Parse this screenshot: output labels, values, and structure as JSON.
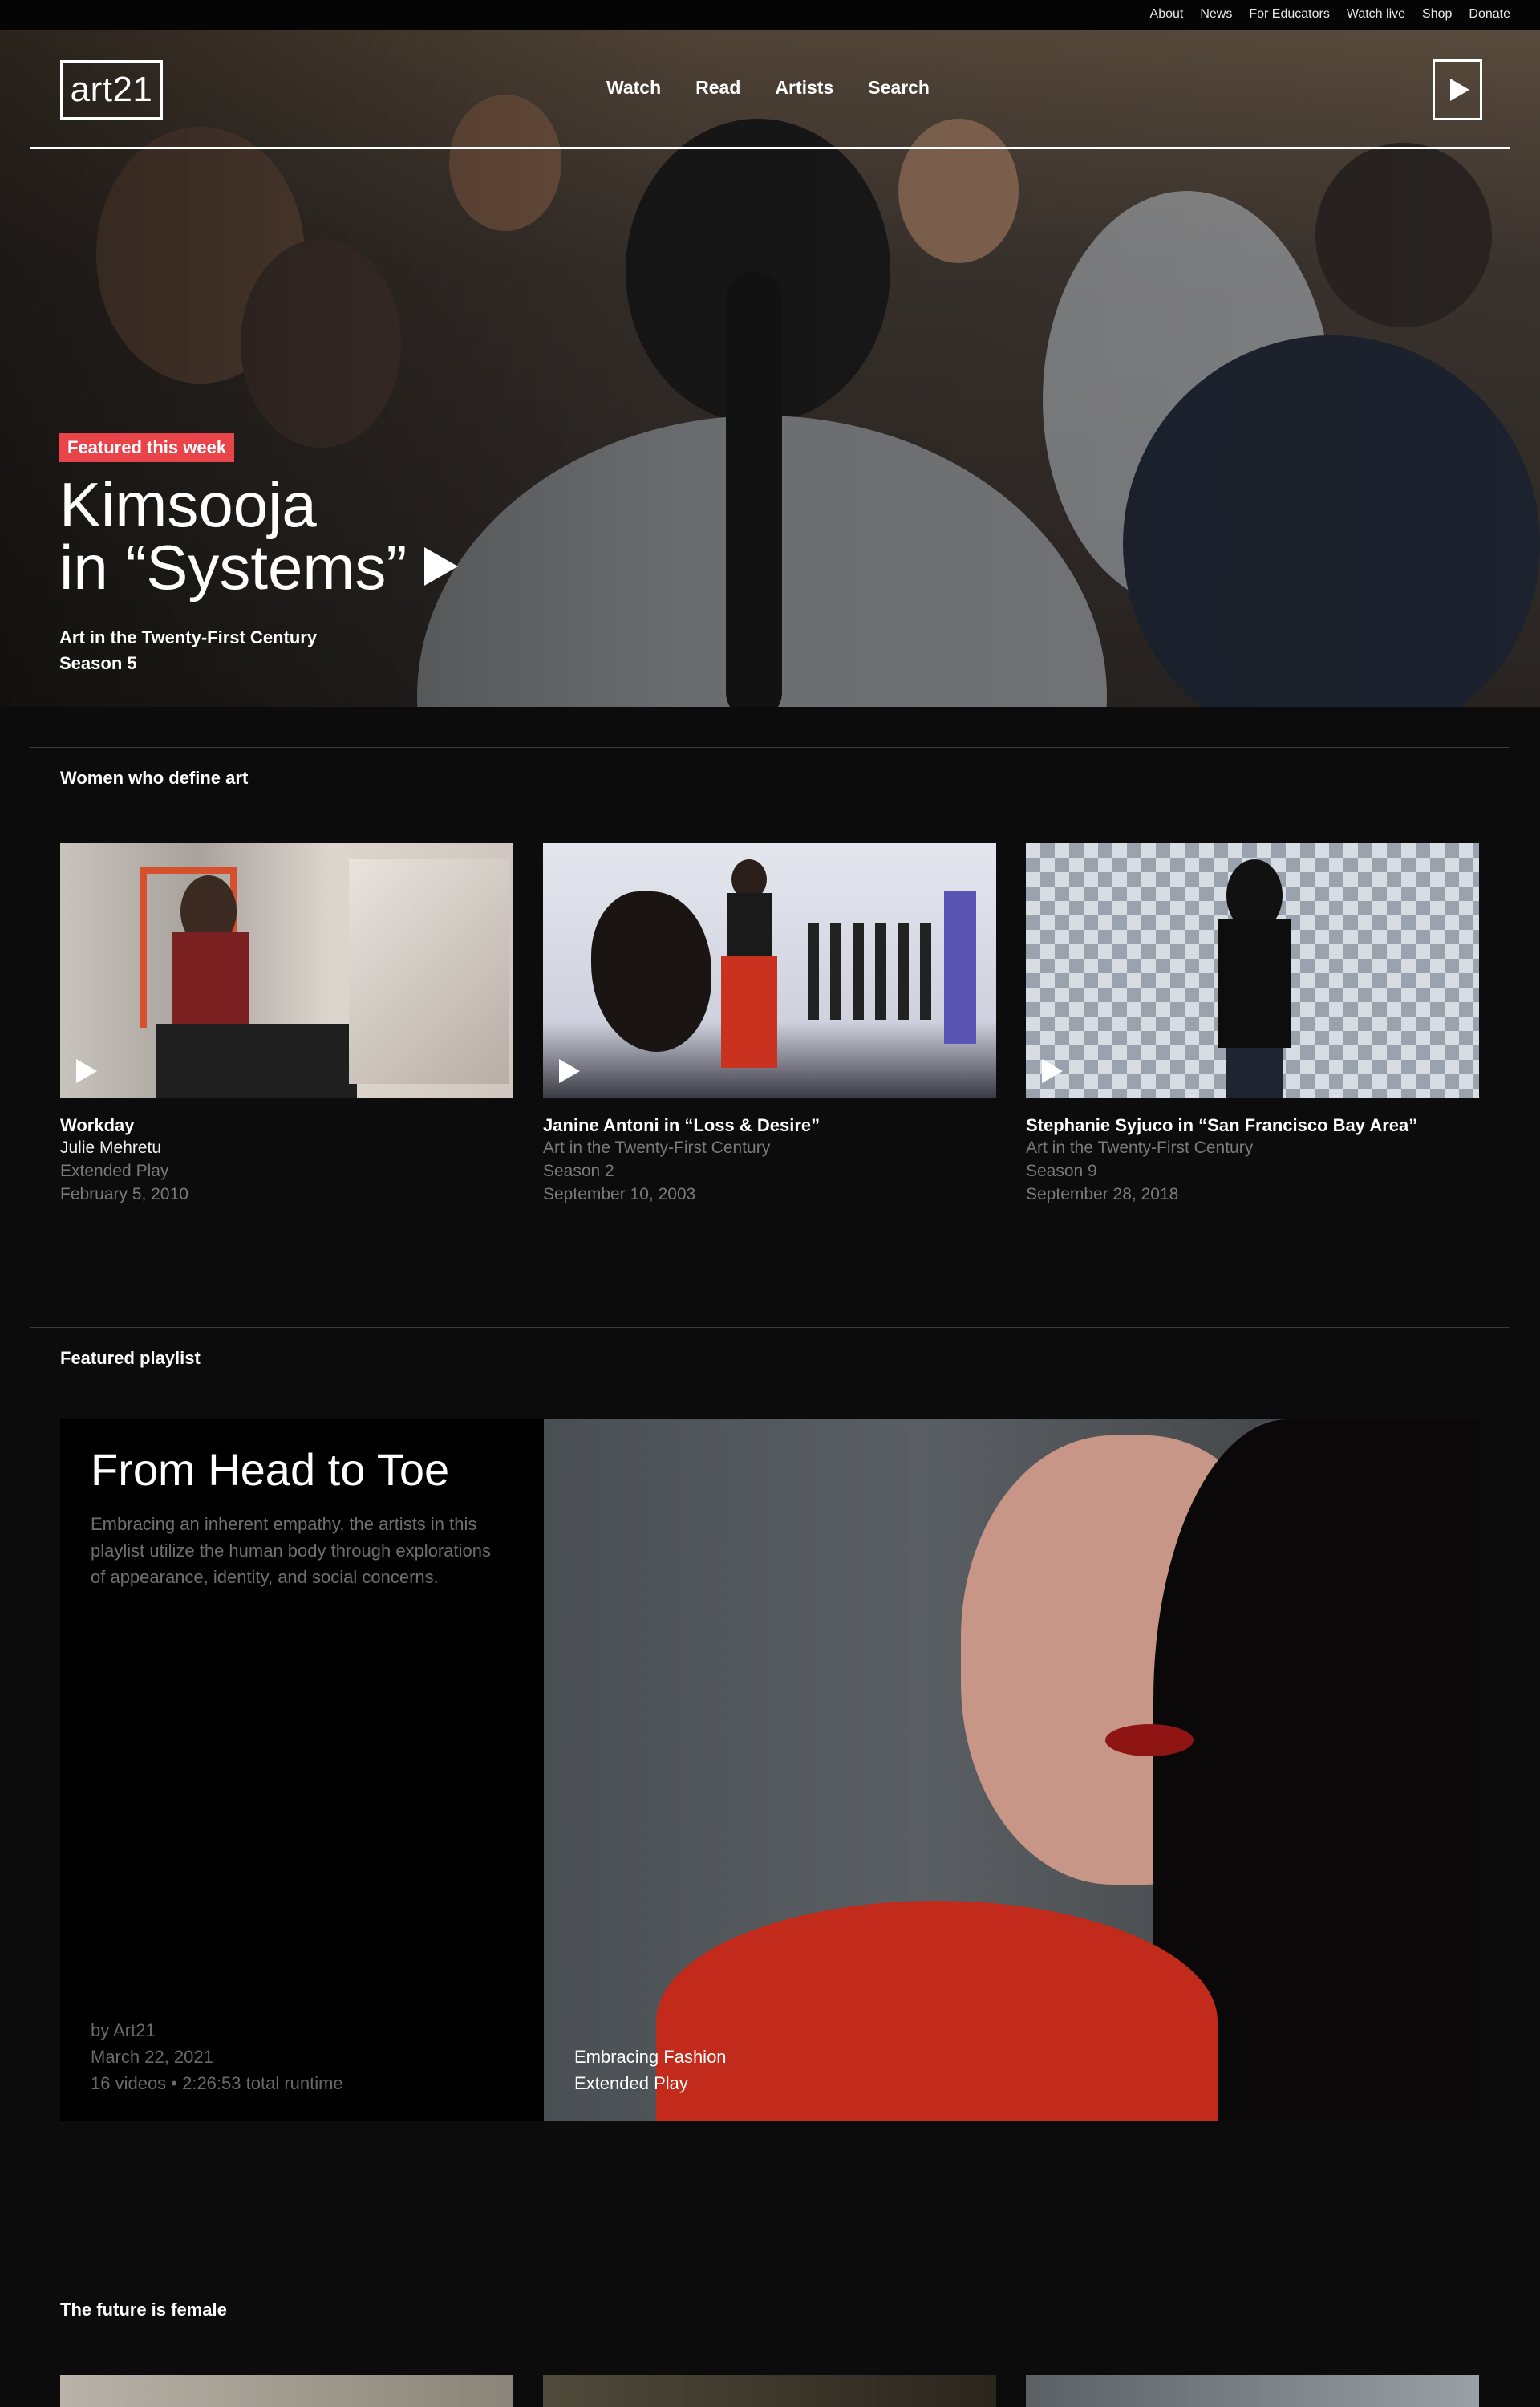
{
  "utility_nav": [
    "About",
    "News",
    "For Educators",
    "Watch live",
    "Shop",
    "Donate"
  ],
  "logo": "art21",
  "main_nav": [
    "Watch",
    "Read",
    "Artists",
    "Search"
  ],
  "hero": {
    "badge": "Featured this week",
    "title_line1": "Kimsooja",
    "title_line2": "in “Systems”",
    "series": "Art in the Twenty-First Century",
    "season": "Season 5"
  },
  "section_women": {
    "title": "Women who define art",
    "cards": [
      {
        "title": "Workday",
        "line1": "Julie Mehretu",
        "line2": "Extended Play",
        "line3": "February 5, 2010",
        "line4": ""
      },
      {
        "title": "Janine Antoni in “Loss & Desire”",
        "line1": "Art in the Twenty-First Century",
        "line2": "Season 2",
        "line3": "September 10, 2003",
        "line4": ""
      },
      {
        "title": "Stephanie Syjuco in “San Francisco Bay Area”",
        "line1": "Art in the Twenty-First Century",
        "line2": "Season 9",
        "line3": "September 28, 2018",
        "line4": ""
      }
    ]
  },
  "section_playlist": {
    "title": "Featured playlist",
    "playlist_title": "From Head to Toe",
    "description": "Embracing an inherent empathy, the artists in this playlist utilize the human body through explorations of appearance, identity, and social concerns.",
    "by": "by Art21",
    "date": "March 22, 2021",
    "stats": "16 videos • 2:26:53 total runtime",
    "feature_title": "Embracing Fashion",
    "feature_series": "Extended Play"
  },
  "section_future": {
    "title": "The future is female"
  },
  "colors": {
    "accent": "#e94449",
    "background": "#0c0c0c",
    "muted_text": "#7a7a7a"
  }
}
